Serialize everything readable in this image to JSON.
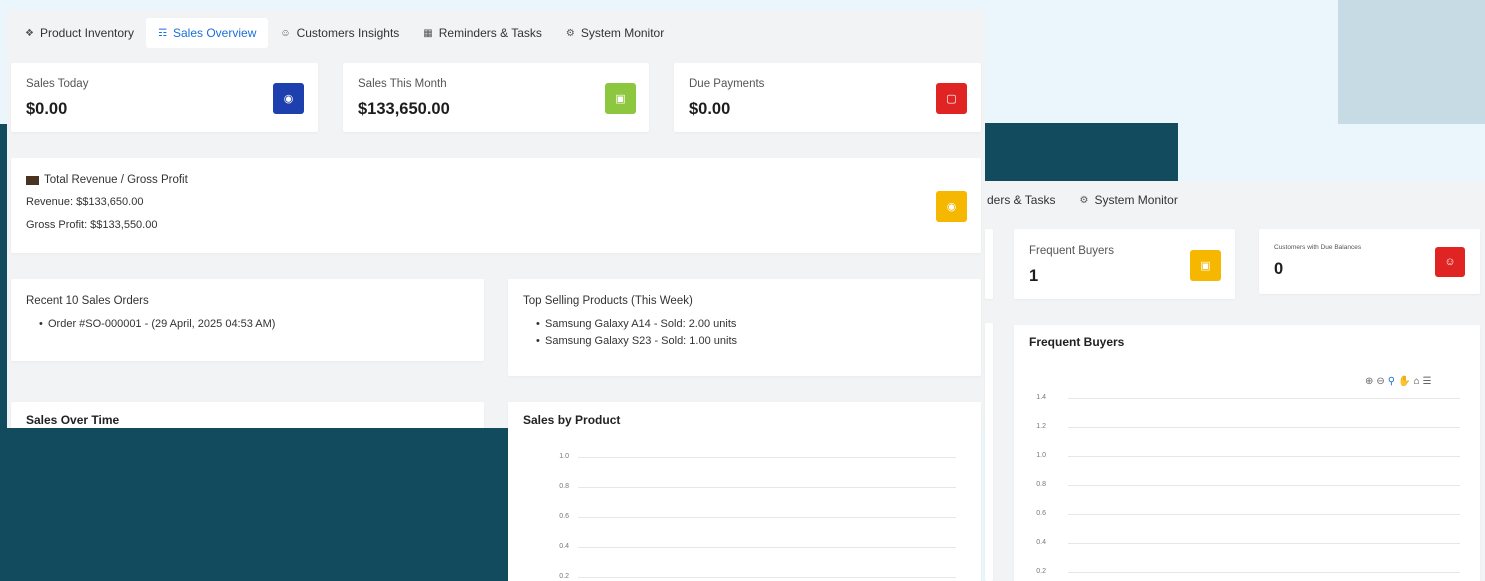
{
  "main": {
    "tabs": [
      {
        "label": "Product Inventory",
        "icon": "box-icon"
      },
      {
        "label": "Sales Overview",
        "icon": "cart-icon",
        "active": true
      },
      {
        "label": "Customers Insights",
        "icon": "user-icon"
      },
      {
        "label": "Reminders & Tasks",
        "icon": "calendar-icon"
      },
      {
        "label": "System Monitor",
        "icon": "gear-icon"
      }
    ],
    "stats": [
      {
        "label": "Sales Today",
        "value": "$0.00",
        "icon_color": "#1e40af"
      },
      {
        "label": "Sales This Month",
        "value": "$133,650.00",
        "icon_color": "#8dc63f"
      },
      {
        "label": "Due Payments",
        "value": "$0.00",
        "icon_color": "#e02424"
      }
    ],
    "revenue": {
      "title": "Total Revenue / Gross Profit",
      "revenue": "Revenue: $$133,650.00",
      "gross": "Gross Profit: $$133,550.00",
      "icon_color": "#f5b700"
    },
    "recent_orders": {
      "title": "Recent 10 Sales Orders",
      "items": [
        "Order #SO-000001 - (29 April, 2025 04:53 AM)"
      ]
    },
    "top_products": {
      "title": "Top Selling Products (This Week)",
      "items": [
        "Samsung Galaxy A14 - Sold: 2.00 units",
        "Samsung Galaxy S23 - Sold: 1.00 units"
      ]
    },
    "sales_over_time": {
      "title": "Sales Over Time"
    },
    "sales_by_product": {
      "title": "Sales by Product",
      "yticks": [
        "1.0",
        "0.8",
        "0.6",
        "0.4",
        "0.2"
      ]
    }
  },
  "secondary": {
    "tabs_partial": [
      {
        "label": "ders & Tasks"
      },
      {
        "label": "System Monitor",
        "icon": "gear-icon"
      }
    ],
    "stats": [
      {
        "label": "Frequent Buyers",
        "value": "1",
        "icon_color": "#f5b700"
      },
      {
        "label": "Customers with Due Balances",
        "value": "0",
        "icon_color": "#e02424"
      }
    ],
    "chart": {
      "title": "Frequent Buyers",
      "yticks": [
        "1.4",
        "1.2",
        "1.0",
        "0.8",
        "0.6",
        "0.4",
        "0.2"
      ]
    }
  }
}
